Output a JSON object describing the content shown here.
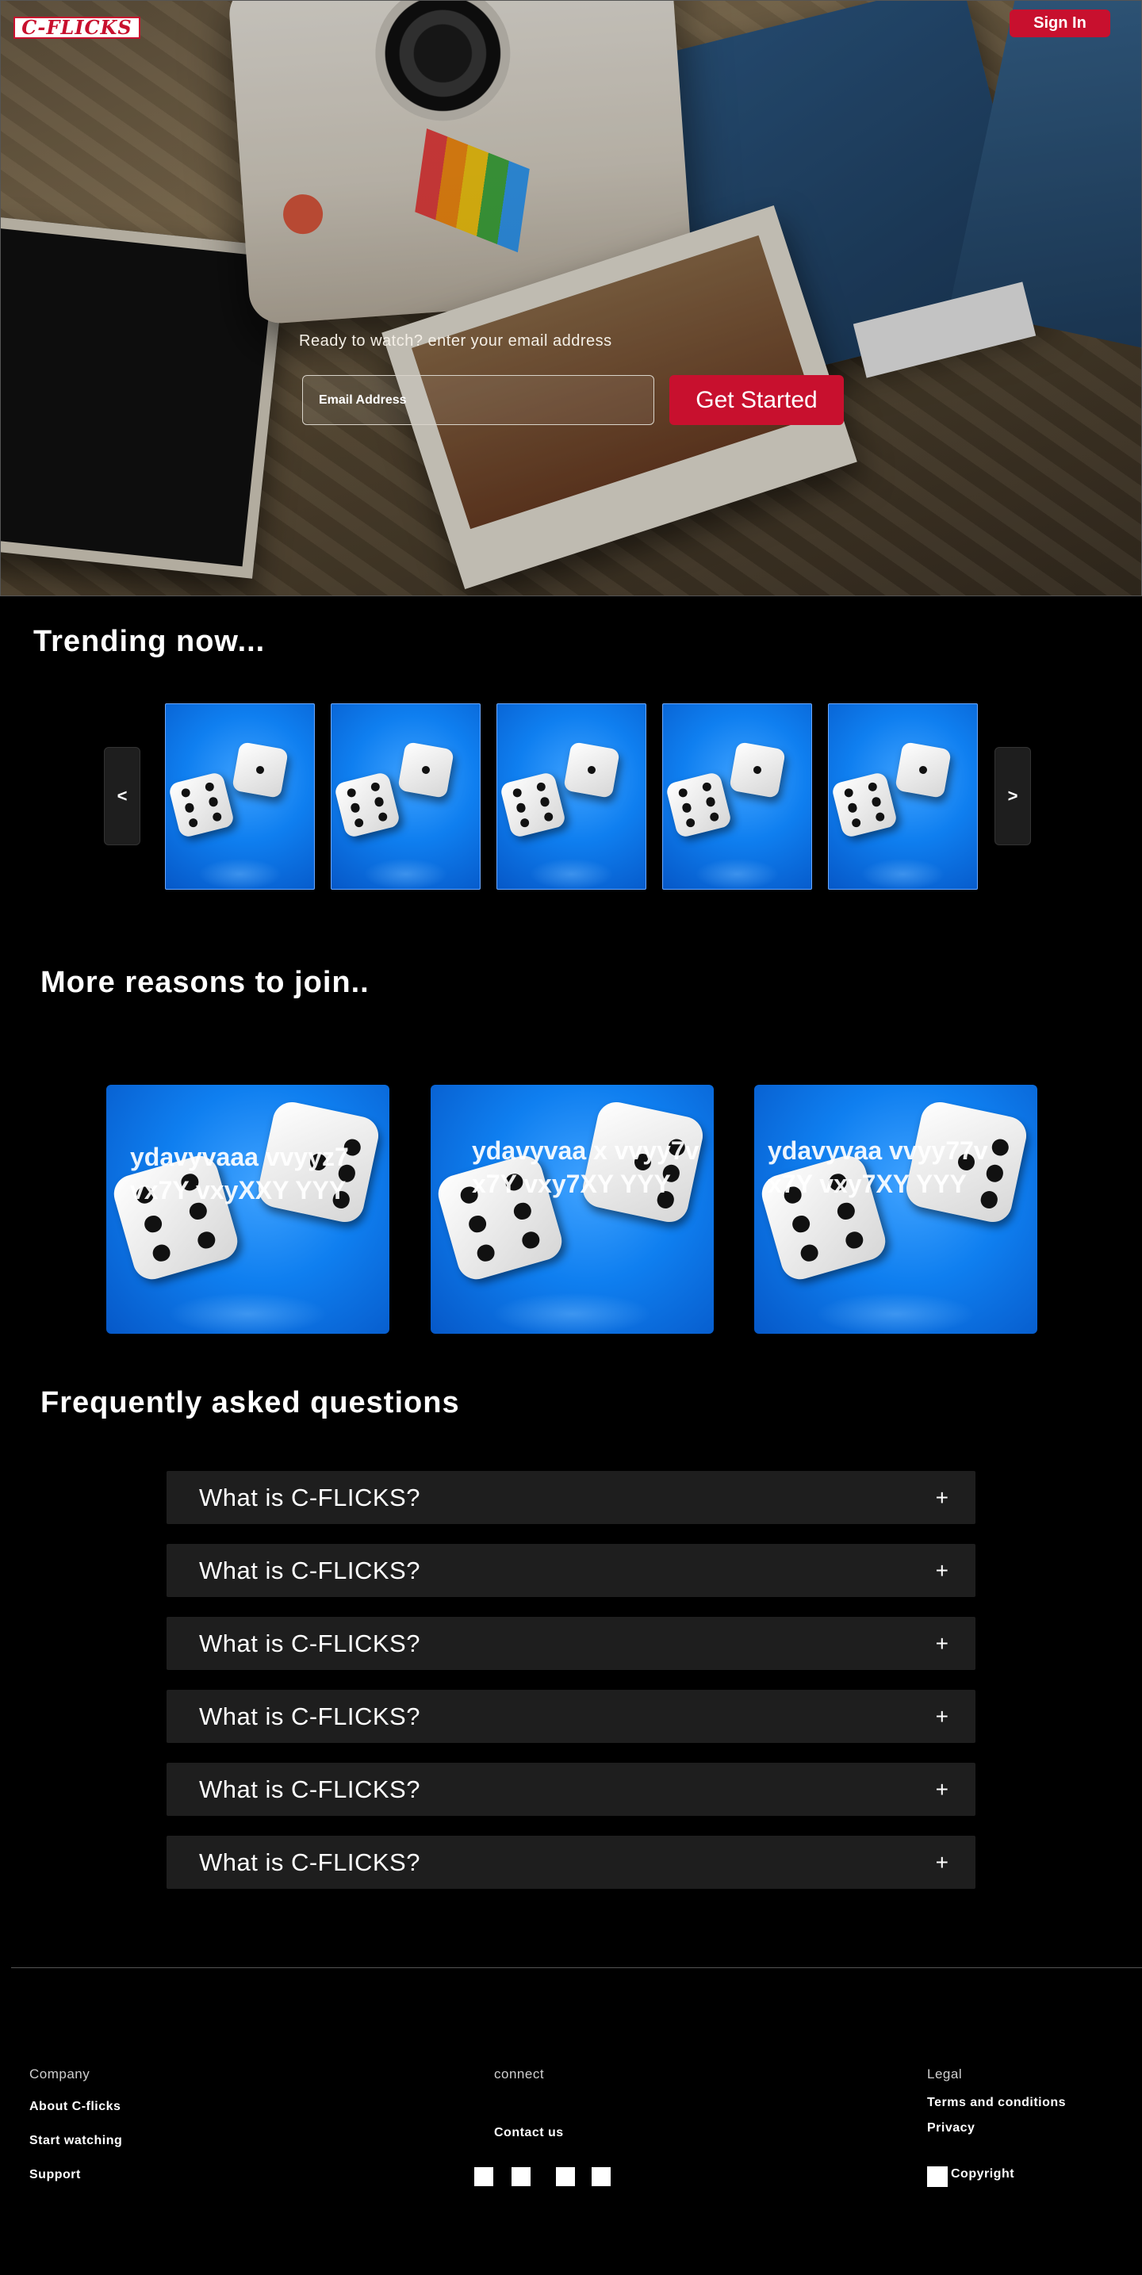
{
  "header": {
    "logo_text": "C-FLICKS",
    "signin_label": "Sign In",
    "brand_color": "#c8102e"
  },
  "hero": {
    "cta_text": "Ready to watch? enter your email address",
    "email_placeholder": "Email Address",
    "get_started_label": "Get Started"
  },
  "trending": {
    "title": "Trending now...",
    "prev_label": "<",
    "next_label": ">",
    "items": [
      "dice-image",
      "dice-image",
      "dice-image",
      "dice-image",
      "dice-image"
    ]
  },
  "reasons": {
    "title": "More reasons to join..",
    "cards": [
      {
        "text": "ydavyvaaa vvyyz7vx7Y vxyXXY YYY"
      },
      {
        "text": "ydavyvaa x vvyy7vx7Y vxy7XY YYY"
      },
      {
        "text": "ydavyvaa vvyy77vx7Y vxy7XY YYY"
      }
    ]
  },
  "faq": {
    "title": "Frequently asked questions",
    "items": [
      {
        "question": "What is C-FLICKS?",
        "icon": "+"
      },
      {
        "question": "What is C-FLICKS?",
        "icon": "+"
      },
      {
        "question": "What is C-FLICKS?",
        "icon": "+"
      },
      {
        "question": "What is C-FLICKS?",
        "icon": "+"
      },
      {
        "question": "What is C-FLICKS?",
        "icon": "+"
      },
      {
        "question": "What is C-FLICKS?",
        "icon": "+"
      }
    ]
  },
  "footer": {
    "company": {
      "heading": "Company",
      "links": [
        "About C-flicks",
        "Start watching",
        "Support"
      ]
    },
    "connect": {
      "heading": "connect",
      "contact": "Contact us",
      "social_icons": [
        "social-icon-1",
        "social-icon-2",
        "social-icon-3",
        "social-icon-4"
      ]
    },
    "legal": {
      "heading": "Legal",
      "links": [
        "Terms and conditions",
        "Privacy"
      ],
      "copyright": "Copyright"
    }
  }
}
